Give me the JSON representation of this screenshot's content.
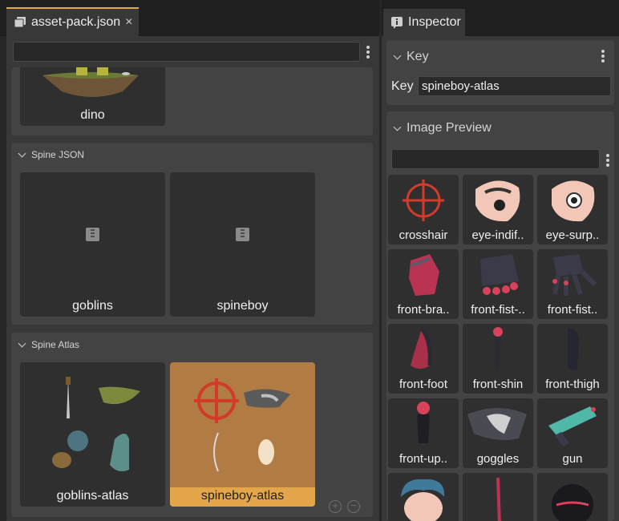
{
  "editor": {
    "tab_title": "asset-pack.json",
    "tab_close": "×",
    "filter_placeholder": "",
    "sections": {
      "images": {
        "items": [
          {
            "label": "dino"
          }
        ]
      },
      "spine_json": {
        "title": "Spine JSON",
        "items": [
          {
            "label": "goblins"
          },
          {
            "label": "spineboy"
          }
        ]
      },
      "spine_atlas": {
        "title": "Spine Atlas",
        "items": [
          {
            "label": "goblins-atlas"
          },
          {
            "label": "spineboy-atlas",
            "selected": true
          }
        ]
      }
    },
    "zoom_in": "+",
    "zoom_out": "−"
  },
  "inspector": {
    "tab_title": "Inspector",
    "key_section": {
      "title": "Key",
      "label": "Key",
      "value": "spineboy-atlas"
    },
    "preview_section": {
      "title": "Image Preview",
      "filter_placeholder": "",
      "thumbnails": [
        {
          "label": "crosshair",
          "icon": "crosshair-icon"
        },
        {
          "label": "eye-indif..",
          "icon": "eye-indifferent-icon"
        },
        {
          "label": "eye-surp..",
          "icon": "eye-surprised-icon"
        },
        {
          "label": "front-bra..",
          "icon": "front-bracer-icon"
        },
        {
          "label": "front-fist-..",
          "icon": "front-fist-closed-icon"
        },
        {
          "label": "front-fist..",
          "icon": "front-fist-open-icon"
        },
        {
          "label": "front-foot",
          "icon": "front-foot-icon"
        },
        {
          "label": "front-shin",
          "icon": "front-shin-icon"
        },
        {
          "label": "front-thigh",
          "icon": "front-thigh-icon"
        },
        {
          "label": "front-up..",
          "icon": "front-upper-arm-icon"
        },
        {
          "label": "goggles",
          "icon": "goggles-icon"
        },
        {
          "label": "gun",
          "icon": "gun-icon"
        },
        {
          "label": "",
          "icon": "head-icon"
        },
        {
          "label": "",
          "icon": "hoverboard-stick-icon"
        },
        {
          "label": "",
          "icon": "hoverglow-icon"
        }
      ]
    }
  },
  "colors": {
    "accent": "#e3a64a",
    "panel": "#383838",
    "section": "#434343",
    "card": "#2f2f2f",
    "selected_card": "#b07c44"
  }
}
